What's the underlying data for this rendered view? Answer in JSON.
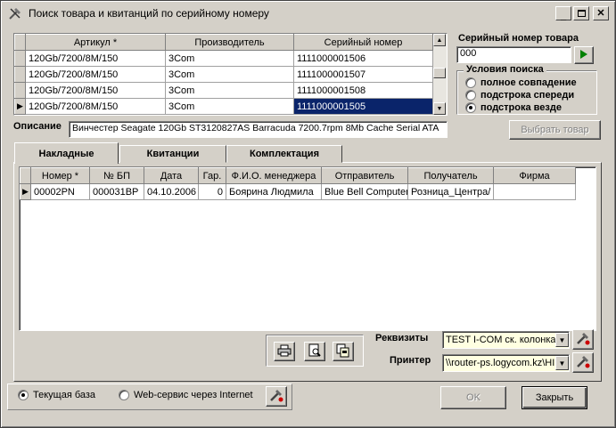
{
  "window": {
    "title": "Поиск товара и квитанций по серийному номеру",
    "icon": "tools-icon"
  },
  "top_grid": {
    "columns": [
      "Артикул *",
      "Производитель",
      "Серийный номер"
    ],
    "rows": [
      [
        "120Gb/7200/8M/150",
        "3Com",
        "1111000001506"
      ],
      [
        "120Gb/7200/8M/150",
        "3Com",
        "1111000001507"
      ],
      [
        "120Gb/7200/8M/150",
        "3Com",
        "1111000001508"
      ],
      [
        "120Gb/7200/8M/150",
        "3Com",
        "1111000001505"
      ]
    ],
    "current_row": 3
  },
  "serial": {
    "label": "Серийный номер товара",
    "value": "000"
  },
  "search": {
    "group_label": "Условия поиска",
    "options": [
      "полное совпадение",
      "подстрока спереди",
      "подстрока везде"
    ],
    "selected": 2
  },
  "description": {
    "label": "Описание",
    "value": "Винчестер Seagate 120Gb ST3120827AS Barracuda 7200.7rpm 8Mb Cache Serial ATA"
  },
  "select_button": "Выбрать товар",
  "tabs": [
    "Накладные",
    "Квитанции",
    "Комплектация"
  ],
  "active_tab": 0,
  "bottom_grid": {
    "columns": [
      "Номер *",
      "№ БП",
      "Дата",
      "Гар.",
      "Ф.И.О. менеджера",
      "Отправитель",
      "Получатель",
      "Фирма"
    ],
    "rows": [
      [
        "00002PN",
        "000031BP",
        "04.10.2006",
        "0",
        "Боярина Людмила",
        "Blue Bell Computer",
        "Розница_Центра/",
        ""
      ]
    ]
  },
  "requisites": {
    "label": "Реквизиты",
    "value": "TEST I-COM ск. колонка"
  },
  "printer": {
    "label": "Принтер",
    "value": "\\\\router-ps.logycom.kz\\HI"
  },
  "database": {
    "options": [
      "Текущая база",
      "Web-сервис через Internet"
    ],
    "selected": 0
  },
  "buttons": {
    "ok": "OK",
    "close": "Закрыть"
  },
  "colors": {
    "selection": "#0a246a",
    "face": "#d4d0c8",
    "go_arrow": "#008000"
  }
}
